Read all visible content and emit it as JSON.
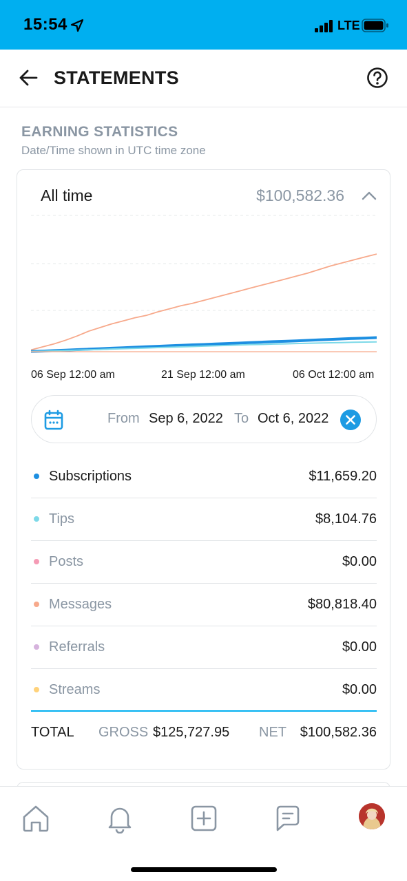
{
  "status_bar": {
    "time": "15:54",
    "network": "LTE"
  },
  "header": {
    "title": "STATEMENTS",
    "back_icon": "arrow-left-icon",
    "help_icon": "question-circle-icon"
  },
  "section": {
    "title": "EARNING STATISTICS",
    "subtitle": "Date/Time shown in UTC time zone"
  },
  "period": {
    "label": "All time",
    "total": "$100,582.36"
  },
  "chart_data": {
    "type": "line",
    "x_ticks": [
      "06 Sep 12:00 am",
      "21 Sep 12:00 am",
      "06 Oct 12:00 am"
    ],
    "y_max": 90000,
    "series": [
      {
        "color": "#f7a98b",
        "values": [
          1500,
          4000,
          6500,
          9500,
          13000,
          17000,
          20000,
          23000,
          25500,
          28000,
          30000,
          33000,
          35500,
          38000,
          40000,
          42500,
          45000,
          47500,
          50000,
          52500,
          55000,
          57500,
          60000,
          62500,
          65000,
          68000,
          71000,
          73500,
          76000,
          78500,
          80818
        ]
      },
      {
        "color": "#1d8fe1",
        "values": [
          200,
          500,
          900,
          1300,
          1700,
          2100,
          2500,
          2900,
          3300,
          3700,
          4100,
          4500,
          4900,
          5300,
          5700,
          6000,
          6400,
          6800,
          7100,
          7500,
          7900,
          8300,
          8600,
          9000,
          9400,
          9800,
          10200,
          10600,
          11000,
          11300,
          11659
        ]
      },
      {
        "color": "#7dd9e8",
        "values": [
          150,
          400,
          700,
          1000,
          1300,
          1600,
          1900,
          2200,
          2500,
          2800,
          3100,
          3400,
          3700,
          4000,
          4300,
          4600,
          4900,
          5200,
          5500,
          5800,
          6000,
          6300,
          6500,
          6800,
          7000,
          7200,
          7400,
          7600,
          7800,
          7950,
          8105
        ]
      },
      {
        "color": "#f7a98b",
        "values": [
          0,
          0,
          0,
          0,
          0,
          0,
          0,
          0,
          0,
          0,
          0,
          0,
          0,
          0,
          0,
          0,
          0,
          0,
          0,
          0,
          0,
          0,
          0,
          0,
          0,
          0,
          0,
          0,
          0,
          0,
          0
        ]
      }
    ]
  },
  "date_range": {
    "from_label": "From",
    "from": "Sep 6, 2022",
    "to_label": "To",
    "to": "Oct 6, 2022"
  },
  "rows": [
    {
      "label": "Subscriptions",
      "value": "$11,659.20",
      "color": "#1d8fe1"
    },
    {
      "label": "Tips",
      "value": "$8,104.76",
      "color": "#7dd9e8"
    },
    {
      "label": "Posts",
      "value": "$0.00",
      "color": "#f59bb5"
    },
    {
      "label": "Messages",
      "value": "$80,818.40",
      "color": "#f7a98b"
    },
    {
      "label": "Referrals",
      "value": "$0.00",
      "color": "#d6b3dd"
    },
    {
      "label": "Streams",
      "value": "$0.00",
      "color": "#ffd27a"
    }
  ],
  "totals": {
    "label": "TOTAL",
    "gross_label": "GROSS",
    "gross": "$125,727.95",
    "net_label": "NET",
    "net": "$100,582.36"
  },
  "nav": [
    "home-icon",
    "bell-icon",
    "plus-square-icon",
    "chat-icon",
    "avatar"
  ]
}
